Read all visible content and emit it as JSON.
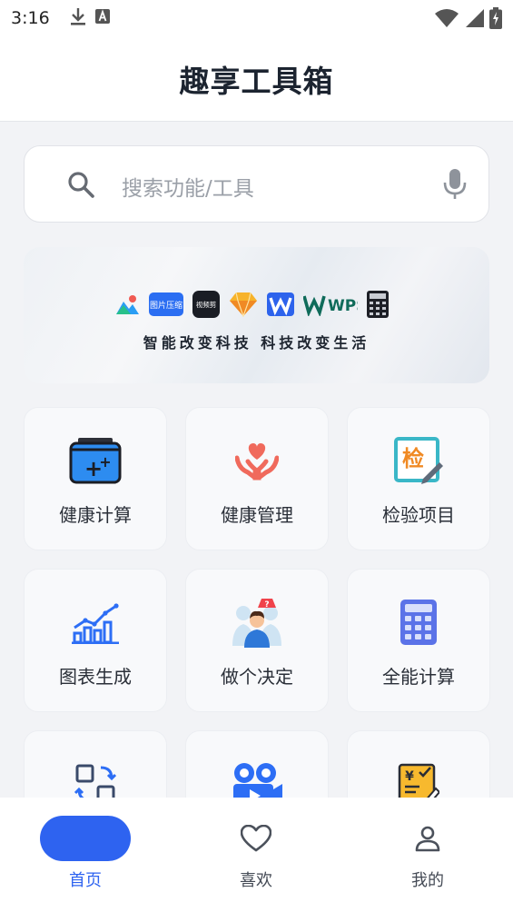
{
  "status_bar": {
    "time": "3:16",
    "icons": [
      "download-icon",
      "text-a-icon",
      "wifi-icon",
      "signal-icon",
      "battery-charging-icon"
    ]
  },
  "header": {
    "title": "趣享工具箱"
  },
  "search": {
    "placeholder": "搜索功能/工具",
    "icon": "search-icon",
    "voice_icon": "mic-icon"
  },
  "banner": {
    "tagline": "智能改变科技  科技改变生活",
    "logos": [
      "image-app-logo",
      "图片压缩",
      "视频剪",
      "sketch-logo",
      "wps-logo",
      "WPS",
      "calculator-logo"
    ]
  },
  "tools": [
    {
      "label": "健康计算",
      "icon": "health-calc-icon"
    },
    {
      "label": "健康管理",
      "icon": "heart-hands-icon"
    },
    {
      "label": "检验项目",
      "icon": "inspection-icon",
      "glyph": "检"
    },
    {
      "label": "图表生成",
      "icon": "chart-icon"
    },
    {
      "label": "做个决定",
      "icon": "decision-icon"
    },
    {
      "label": "全能计算",
      "icon": "calculator-icon"
    },
    {
      "label": "",
      "icon": "convert-icon"
    },
    {
      "label": "",
      "icon": "video-camera-icon"
    },
    {
      "label": "",
      "icon": "price-tag-icon",
      "glyph": "¥"
    }
  ],
  "tabbar": {
    "tabs": [
      {
        "label": "首页",
        "icon": "home-icon",
        "active": true
      },
      {
        "label": "喜欢",
        "icon": "heart-icon",
        "active": false
      },
      {
        "label": "我的",
        "icon": "user-icon",
        "active": false
      }
    ],
    "accent": "#2e63f0"
  }
}
